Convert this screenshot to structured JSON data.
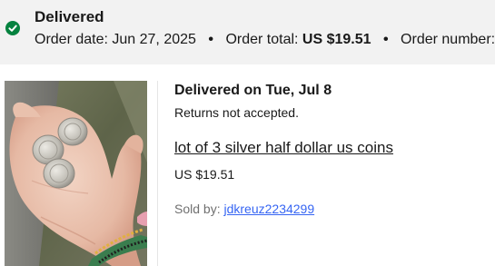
{
  "order": {
    "status": "Delivered",
    "order_date_label": "Order date:",
    "order_date": "Jun 27, 2025",
    "order_total_label": "Order total:",
    "order_total": "US $19.51",
    "order_number_label": "Order number:",
    "separator": "•",
    "status_icon": "checkmark-circle-icon",
    "status_color": "#05823f"
  },
  "item": {
    "delivery_status": "Delivered on Tue, Jul 8",
    "returns_policy": "Returns not accepted.",
    "title": "lot of 3 silver half dollar us coins",
    "price": "US $19.51",
    "sold_by_label": "Sold by:",
    "seller": "jdkreuz2234299",
    "image": "hand-holding-three-silver-coins"
  },
  "colors": {
    "header_background": "#f2f2f2",
    "link": "#3665f3",
    "text": "#191919",
    "secondary_text": "#707070"
  }
}
